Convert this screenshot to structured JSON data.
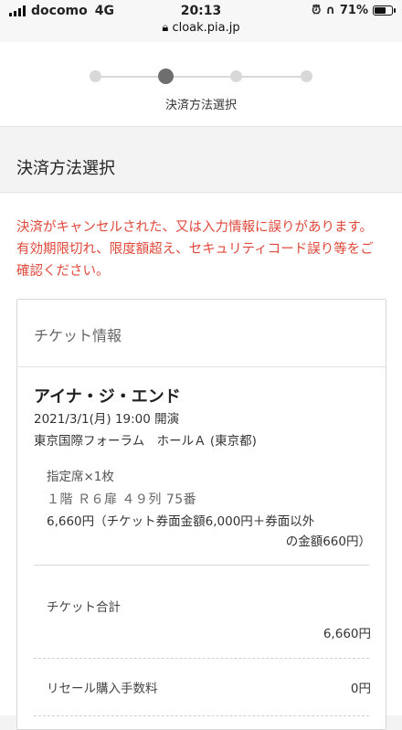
{
  "status_bar": {
    "carrier": "docomo",
    "network": "4G",
    "time": "20:13",
    "url": "cloak.pia.jp",
    "battery": "71%"
  },
  "stepper": {
    "active_label": "決済方法選択",
    "steps_total": 4,
    "active_index": 2
  },
  "page": {
    "section_title": "決済方法選択",
    "error_message": "決済がキャンセルされた、又は入力情報に誤りがあります。有効期限切れ、限度額超え、セキュリティコード誤り等をご確認ください。"
  },
  "ticket": {
    "heading": "チケット情報",
    "artist": "アイナ・ジ・エンド",
    "datetime": "2021/3/1(月) 19:00 開演",
    "venue": "東京国際フォーラム　ホールＡ (東京都)",
    "seat_type": "指定席×1枚",
    "seat_position": "１階 Ｒ６扉 ４９列 75番",
    "price_line1": "6,660円（チケット券面金額6,000円＋券面以外",
    "price_line2": "の金額660円）",
    "total_label": "チケット合計",
    "total_value": "6,660円",
    "resale_fee_label": "リセール購入手数料",
    "resale_fee_value": "0円"
  },
  "colors": {
    "error": "#e0493b",
    "active_step": "#6e6e6e",
    "inactive_step": "#d8d8d8"
  }
}
